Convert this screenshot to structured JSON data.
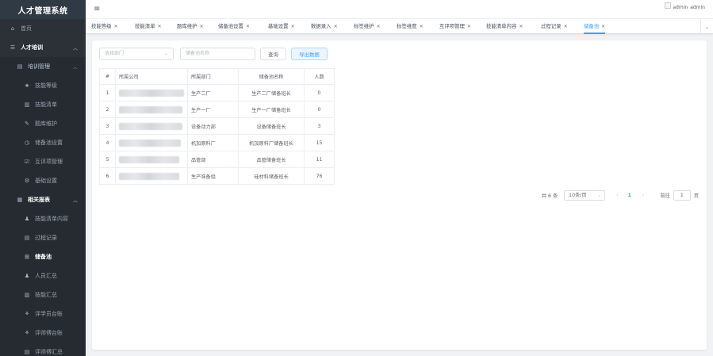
{
  "app": {
    "title": "人才管理系统"
  },
  "header": {
    "user_text_1": "admin",
    "username": "admin"
  },
  "sidebar": {
    "home": "首页",
    "group1": "人才培训",
    "group1_sub": "培训管理",
    "items1": [
      "技能等级",
      "技能清单",
      "题库维护",
      "储备池设置",
      "互评项管理",
      "基础设置"
    ],
    "group2": "相关报表",
    "items2": [
      "技能清单内容",
      "过程记录",
      "储备池",
      "人员汇总",
      "技能汇总",
      "评学员台账",
      "评师傅台账",
      "评师傅汇总"
    ]
  },
  "tags": [
    "技能等级",
    "技能清单",
    "题库维护",
    "储备池设置",
    "基础设置",
    "数据录入",
    "标签维护",
    "标签维度",
    "互评项管理",
    "技能清单内容",
    "过程记录",
    "储备池"
  ],
  "filters": {
    "department_placeholder": "选择部门",
    "pool_name_placeholder": "储备池名称",
    "search_label": "查询",
    "export_label": "导出数据"
  },
  "table": {
    "headers": [
      "#",
      "所属公司",
      "所属部门",
      "储备池名称",
      "人数"
    ],
    "rows": [
      {
        "index": "1",
        "company": "",
        "department": "生产二厂",
        "pool": "生产二厂储备班长",
        "count": "0"
      },
      {
        "index": "2",
        "company": "",
        "department": "生产一厂",
        "pool": "生产一厂储备班长",
        "count": "0"
      },
      {
        "index": "3",
        "company": "",
        "department": "设备动力部",
        "pool": "设备储备班长",
        "count": "3"
      },
      {
        "index": "4",
        "company": "",
        "department": "机加原料厂",
        "pool": "机加原料厂储备班长",
        "count": "15"
      },
      {
        "index": "5",
        "company": "",
        "department": "品管部",
        "pool": "品管储备班长",
        "count": "11"
      },
      {
        "index": "6",
        "company": "",
        "department": "生产准备组",
        "pool": "硅材料储备班长",
        "count": "76"
      }
    ]
  },
  "pagination": {
    "total": "共 6 条",
    "page_size": "10条/页",
    "current_page": "1",
    "goto_label": "前往",
    "goto_value": "1",
    "page_suffix": "页"
  },
  "colors": {
    "accent": "#409eff",
    "sidebar_bg": "#2b3137",
    "logo_bg": "#2f3a44"
  }
}
